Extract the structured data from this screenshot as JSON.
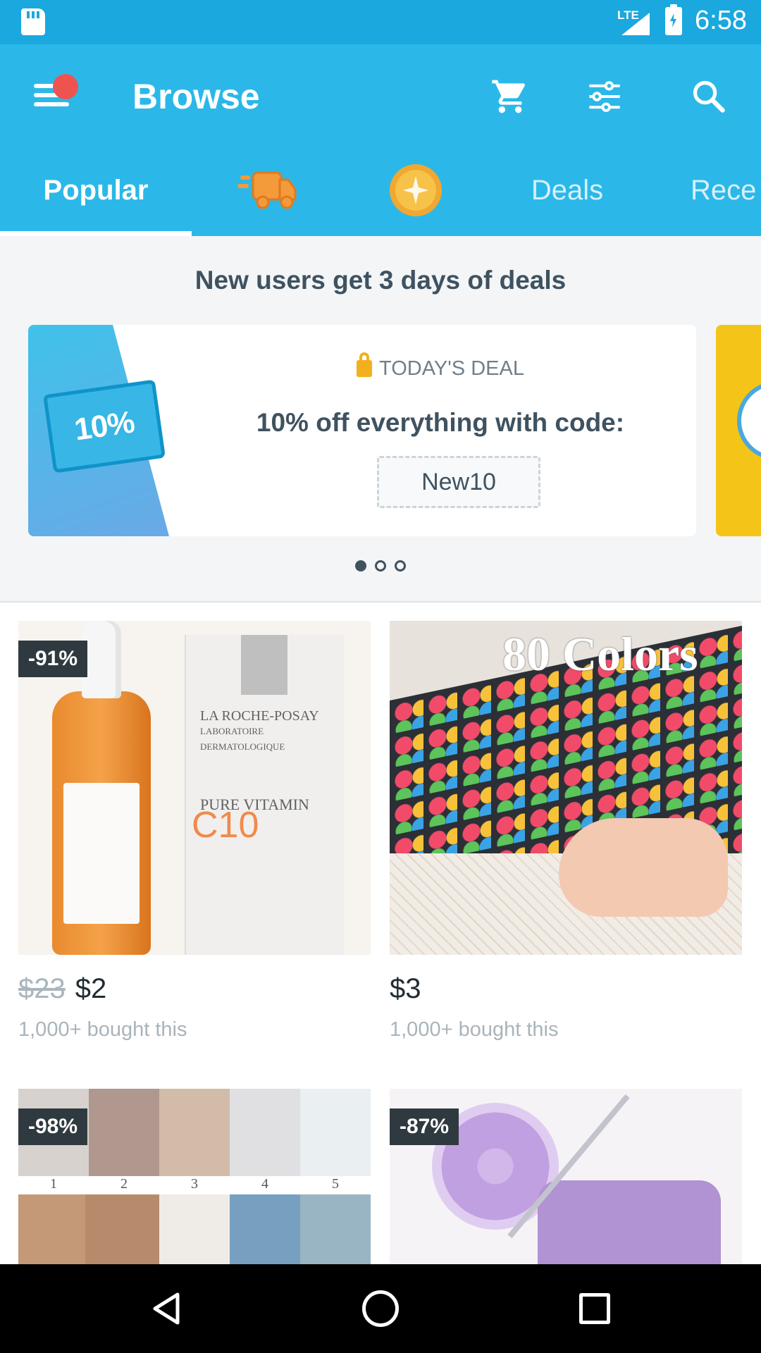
{
  "status_bar": {
    "network": "LTE",
    "time": "6:58",
    "icons": [
      "sd-card-icon",
      "signal-icon",
      "battery-charging-icon"
    ]
  },
  "header": {
    "title": "Browse",
    "icons": [
      "menu-icon",
      "cart-icon",
      "filter-icon",
      "search-icon"
    ],
    "brand_color": "#2bb8e8",
    "notification_color": "#ef5350"
  },
  "tabs": [
    {
      "label": "Popular",
      "selected": true
    },
    {
      "label": "",
      "icon": "shipping-truck-icon"
    },
    {
      "label": "",
      "icon": "coin-icon"
    },
    {
      "label": "Deals"
    },
    {
      "label": "Rece"
    }
  ],
  "promo": {
    "headline": "New users get 3 days of deals",
    "coupon_text": "10%",
    "deal_label": "TODAY'S DEAL",
    "deal_text": "10% off everything with code:",
    "code": "New10",
    "page_count": 3,
    "active_page": 1
  },
  "products": [
    {
      "badge": "-91%",
      "old_price": "$23",
      "price": "$2",
      "bought": "1,000+ bought this",
      "image": "serum"
    },
    {
      "badge": "",
      "old_price": "",
      "price": "$3",
      "bought": "1,000+ bought this",
      "image": "markers",
      "image_text": "80 Colors"
    },
    {
      "badge": "-98%",
      "image": "backdrops",
      "image_numbers": [
        "1",
        "2",
        "3",
        "4",
        "5"
      ]
    },
    {
      "badge": "-87%",
      "image": "mop"
    }
  ],
  "serum_box": {
    "brand": "LA ROCHE-POSAY",
    "sub": "LABORATOIRE DERMATOLOGIQUE",
    "product": "PURE VITAMIN",
    "c10": "C10"
  },
  "nav_bar": {
    "icons": [
      "back-icon",
      "home-icon",
      "recents-icon"
    ]
  }
}
